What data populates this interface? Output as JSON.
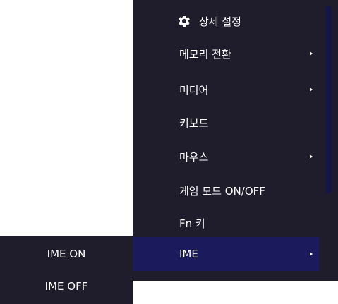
{
  "menu": {
    "header": {
      "label": "상세 설정",
      "icon": "gear-icon"
    },
    "items": [
      {
        "label": "메모리 전환",
        "has_submenu": true
      },
      {
        "label": "미디어",
        "has_submenu": true
      },
      {
        "label": "키보드",
        "has_submenu": false
      },
      {
        "label": "마우스",
        "has_submenu": true
      },
      {
        "label": "게임 모드 ON/OFF",
        "has_submenu": false
      },
      {
        "label": "Fn 키",
        "has_submenu": false
      },
      {
        "label": "IME",
        "has_submenu": true,
        "selected": true
      }
    ]
  },
  "submenu": {
    "items": [
      {
        "label": "IME ON"
      },
      {
        "label": "IME OFF"
      }
    ]
  },
  "colors": {
    "menu_background": "#1f1c2c",
    "selected_background": "#1b1a5c",
    "scrollbar": "#15154a",
    "text": "#ffffff"
  }
}
